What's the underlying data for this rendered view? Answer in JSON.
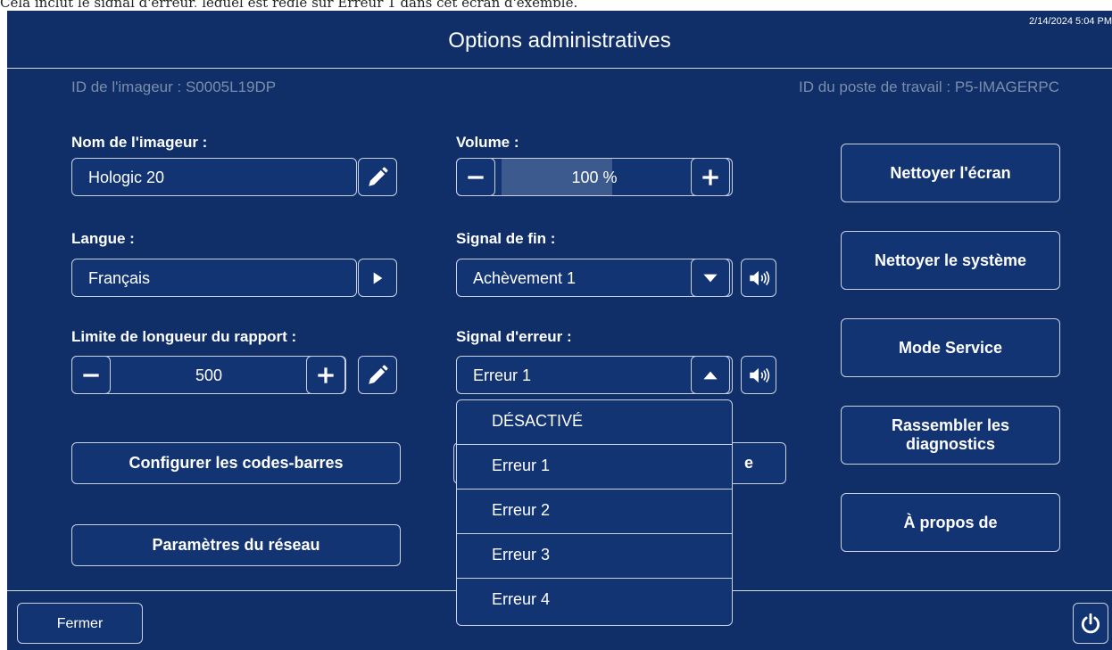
{
  "top_caption": "Cela inclut le signal d'erreur, lequel est réglé sur Erreur 1 dans cet écran d'exemple.",
  "header": {
    "title": "Options administratives",
    "timestamp": "2/14/2024 5:04 PM"
  },
  "info": {
    "imager_id": "ID de l'imageur : S0005L19DP",
    "workstation_id": "ID du poste de travail : P5-IMAGERPC"
  },
  "imager_name": {
    "label": "Nom de l'imageur :",
    "value": "Hologic 20"
  },
  "language": {
    "label": "Langue :",
    "value": "Français"
  },
  "report_limit": {
    "label": "Limite de longueur du rapport :",
    "value": "500"
  },
  "volume": {
    "label": "Volume :",
    "value": "100 %",
    "level": 0.58
  },
  "end_signal": {
    "label": "Signal de fin :",
    "value": "Achèvement 1"
  },
  "error_signal": {
    "label": "Signal d'erreur :",
    "value": "Erreur 1",
    "options": [
      "DÉSACTIVÉ",
      "Erreur 1",
      "Erreur 2",
      "Erreur 3",
      "Erreur 4"
    ]
  },
  "buttons": {
    "barcodes": "Configurer les codes-barres",
    "network": "Paramètres du réseau",
    "hidden_fragment": "e",
    "clean_screen": "Nettoyer l'écran",
    "clean_system": "Nettoyer le système",
    "service_mode": "Mode Service",
    "diagnostics": "Rassembler les diagnostics",
    "about": "À propos de",
    "close": "Fermer"
  },
  "icons": {
    "edit": "pencil-icon",
    "next": "play-icon",
    "minus": "minus-icon",
    "plus": "plus-icon",
    "dropdown": "chevron-down-icon",
    "dropup": "chevron-up-icon",
    "speaker": "speaker-icon",
    "power": "power-icon"
  },
  "colors": {
    "background": "#102f68",
    "border": "#c9d1e2",
    "muted_text": "#7c8dab",
    "volume_fill": "#3c5a8e"
  }
}
